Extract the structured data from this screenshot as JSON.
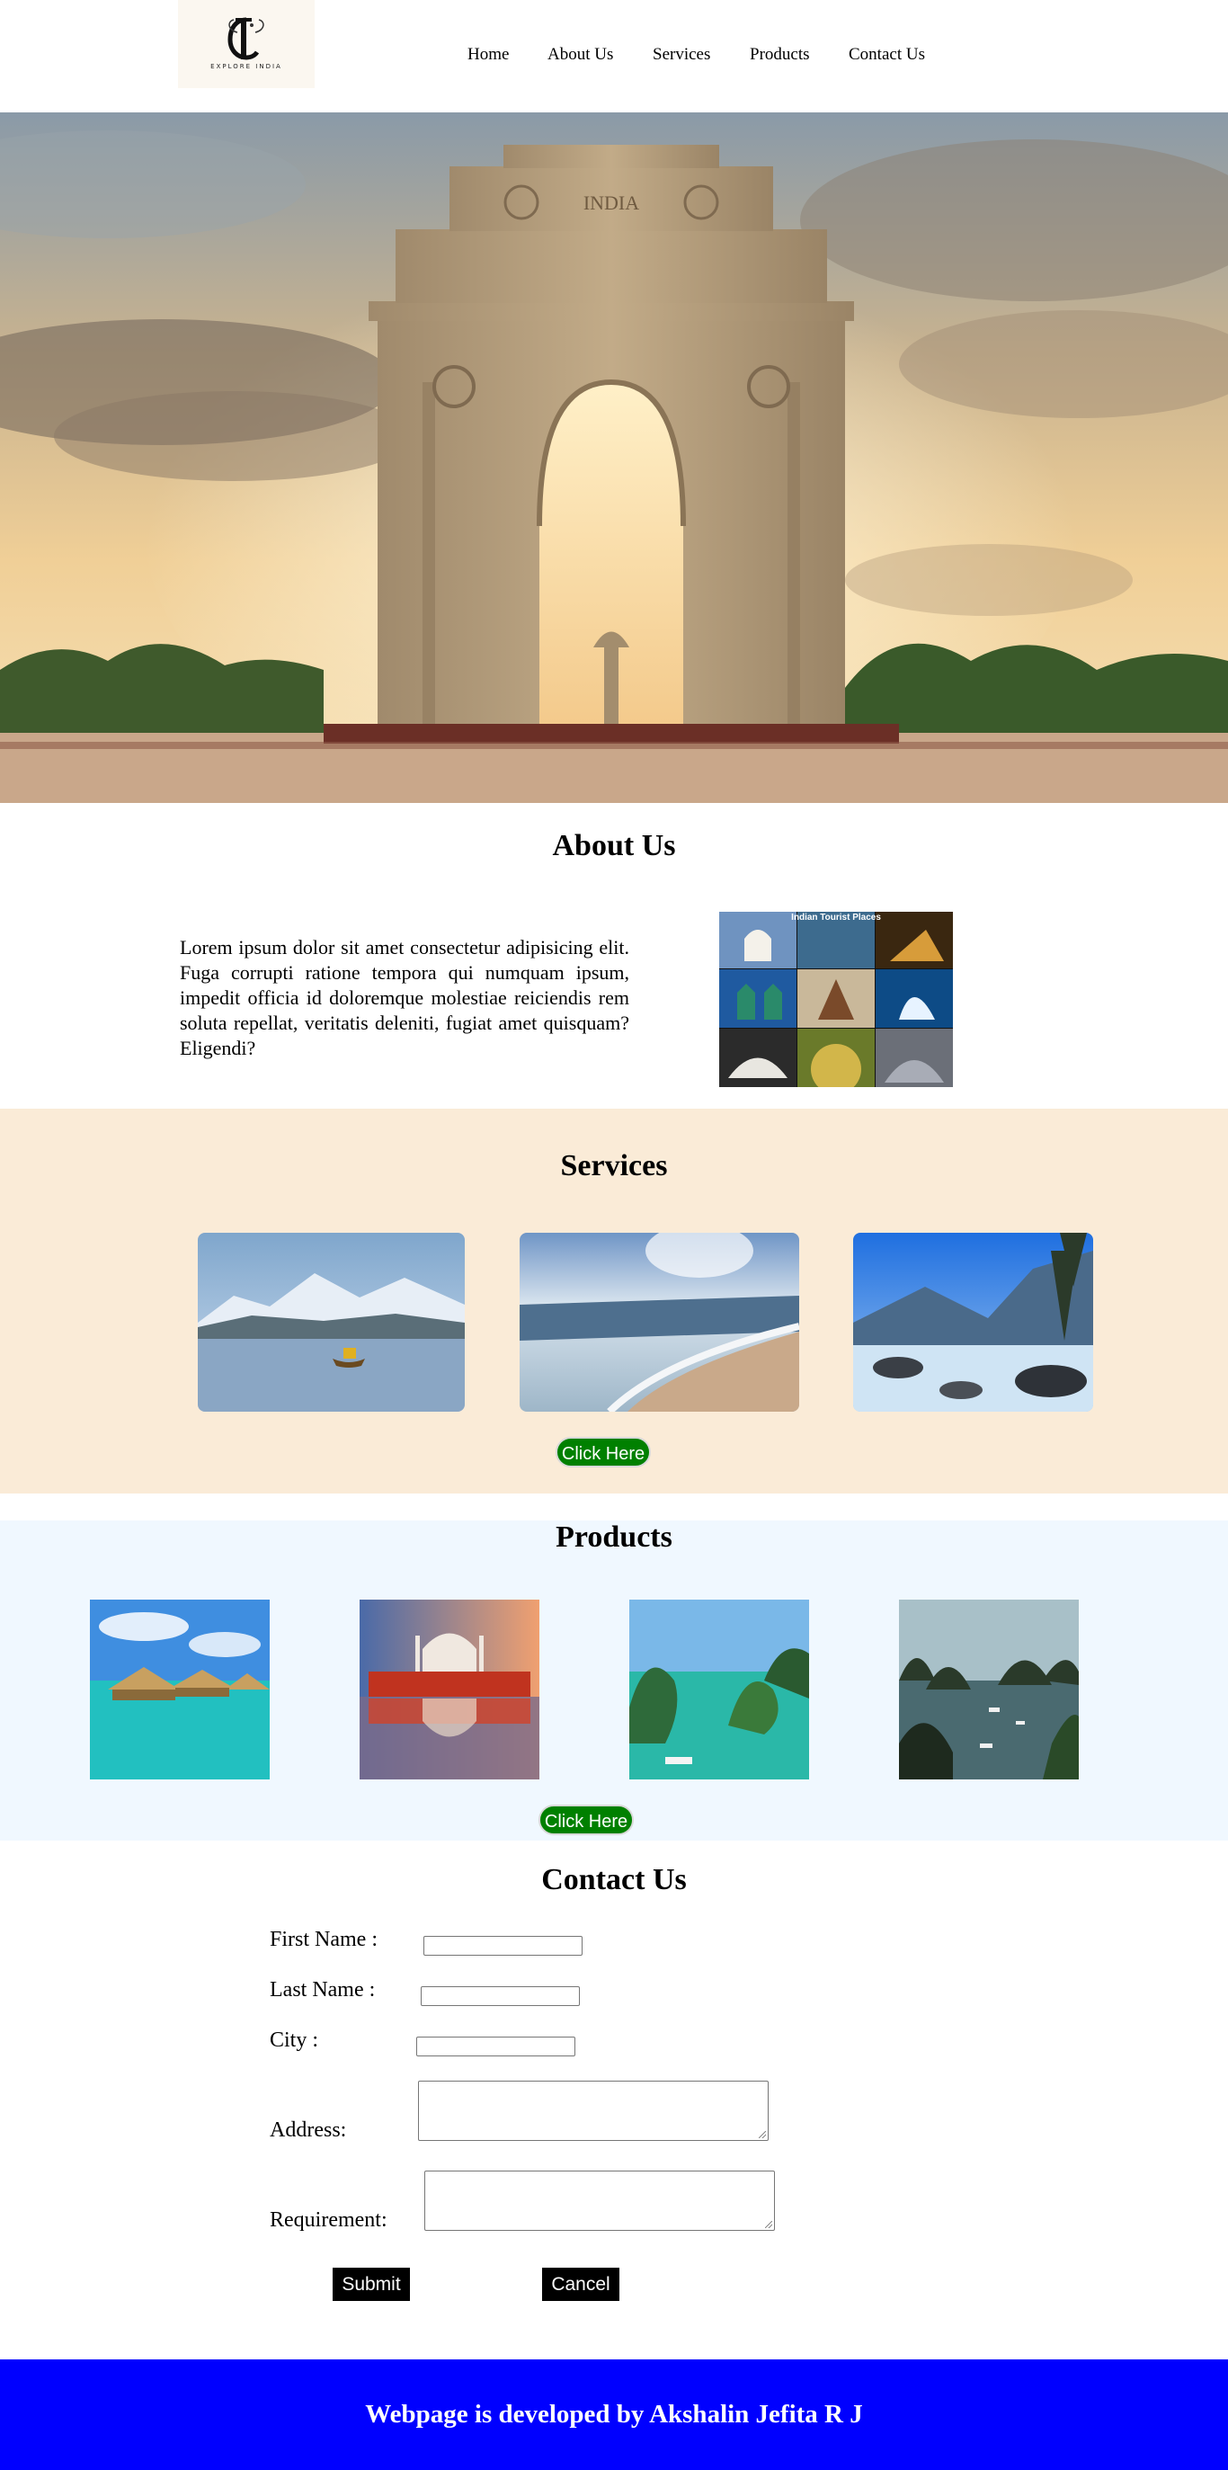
{
  "header": {
    "logo_text": "EXPLORE INDIA",
    "nav": [
      "Home",
      "About Us",
      "Services",
      "Products",
      "Contact Us"
    ]
  },
  "hero": {
    "landmark_inscription": "INDIA"
  },
  "about": {
    "title": "About Us",
    "body": "Lorem ipsum dolor sit amet consectetur adipisicing elit. Fuga corrupti ratione tempora qui numquam ipsum, impedit officia id doloremque molestiae reiciendis rem soluta repellat, veritatis deleniti, fugiat amet quisquam? Eligendi?",
    "collage_caption": "Indian Tourist Places"
  },
  "services": {
    "title": "Services",
    "button_label": "Click Here"
  },
  "products": {
    "title": "Products",
    "button_label": "Click Here"
  },
  "contact": {
    "title": "Contact Us",
    "first_name_label": "First Name :",
    "last_name_label": "Last Name :",
    "city_label": "City :",
    "address_label": "Address:",
    "requirement_label": "Requirement:",
    "submit_label": "Submit",
    "cancel_label": "Cancel",
    "first_name_value": "",
    "last_name_value": "",
    "city_value": ""
  },
  "footer": {
    "text": "Webpage is developed by Akshalin Jefita R J"
  },
  "colors": {
    "services_bg": "#faebd7",
    "products_bg": "#f0f8ff",
    "button_green": "#008000",
    "footer_blue": "#0000ff"
  }
}
